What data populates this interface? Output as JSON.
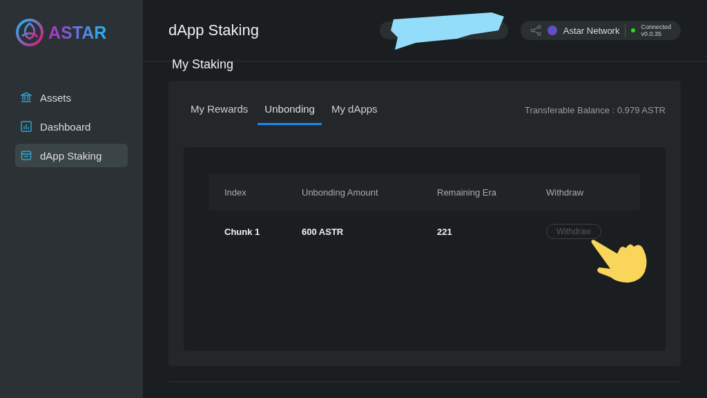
{
  "brand": {
    "name": "ASTAR"
  },
  "sidebar": {
    "items": [
      {
        "label": "Assets",
        "kind": "bank",
        "selected": false
      },
      {
        "label": "Dashboard",
        "kind": "chart",
        "selected": false
      },
      {
        "label": "dApp Staking",
        "kind": "bag",
        "selected": true
      }
    ]
  },
  "header": {
    "title": "dApp Staking",
    "network": {
      "name": "Astar Network",
      "status": "Connected",
      "version": "v0.0.35",
      "color": "#22dd22"
    }
  },
  "section_title": "My Staking",
  "tabs": [
    {
      "label": "My Rewards",
      "selected": false
    },
    {
      "label": "Unbonding",
      "selected": true
    },
    {
      "label": "My dApps",
      "selected": false
    }
  ],
  "balance": "Transferable Balance : 0.979 ASTR",
  "table": {
    "columns": [
      "Index",
      "Unbonding Amount",
      "Remaining Era",
      "Withdraw"
    ],
    "rows": [
      {
        "index": "Chunk 1",
        "amount": "600 ASTR",
        "era": "221",
        "action": "Withdraw",
        "disabled": true
      }
    ]
  }
}
